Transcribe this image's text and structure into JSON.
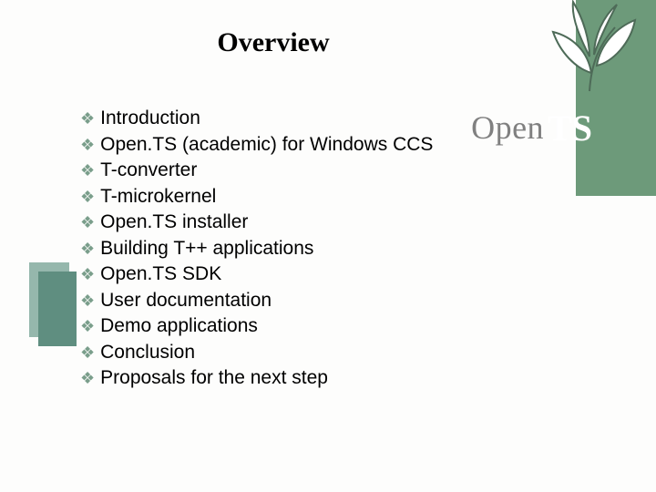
{
  "title": "Overview",
  "logo": {
    "open": "Open",
    "ts": "TS"
  },
  "items": [
    "Introduction",
    "Open.TS (academic) for Windows CCS",
    "T-converter",
    "T-microkernel",
    "Open.TS installer",
    "Building T++ applications",
    "Open.TS SDK",
    "User documentation",
    "Demo applications",
    "Conclusion",
    "Proposals for the next step"
  ]
}
